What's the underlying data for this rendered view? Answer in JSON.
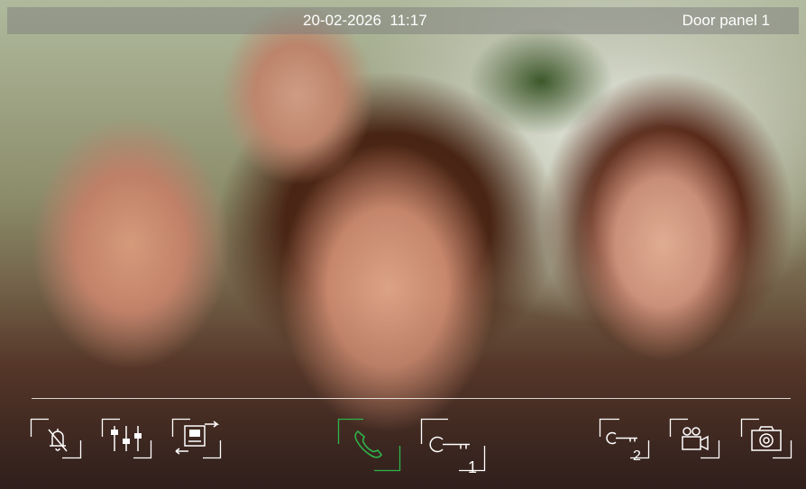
{
  "status_bar": {
    "datetime": "20-02-2026  11:17",
    "panel_name": "Door panel 1"
  },
  "toolbar": {
    "mute_icon": "bell-off-icon",
    "settings_icon": "sliders-icon",
    "transfer_icon": "intercom-transfer-icon",
    "call_icon": "phone-handset-icon",
    "call_color": "#2fb34a",
    "unlock1_icon": "key-icon",
    "unlock1_label": "1",
    "unlock2_icon": "key-icon",
    "unlock2_label": "2",
    "camera_switch_icon": "video-camera-icon",
    "snapshot_icon": "photo-camera-icon"
  }
}
